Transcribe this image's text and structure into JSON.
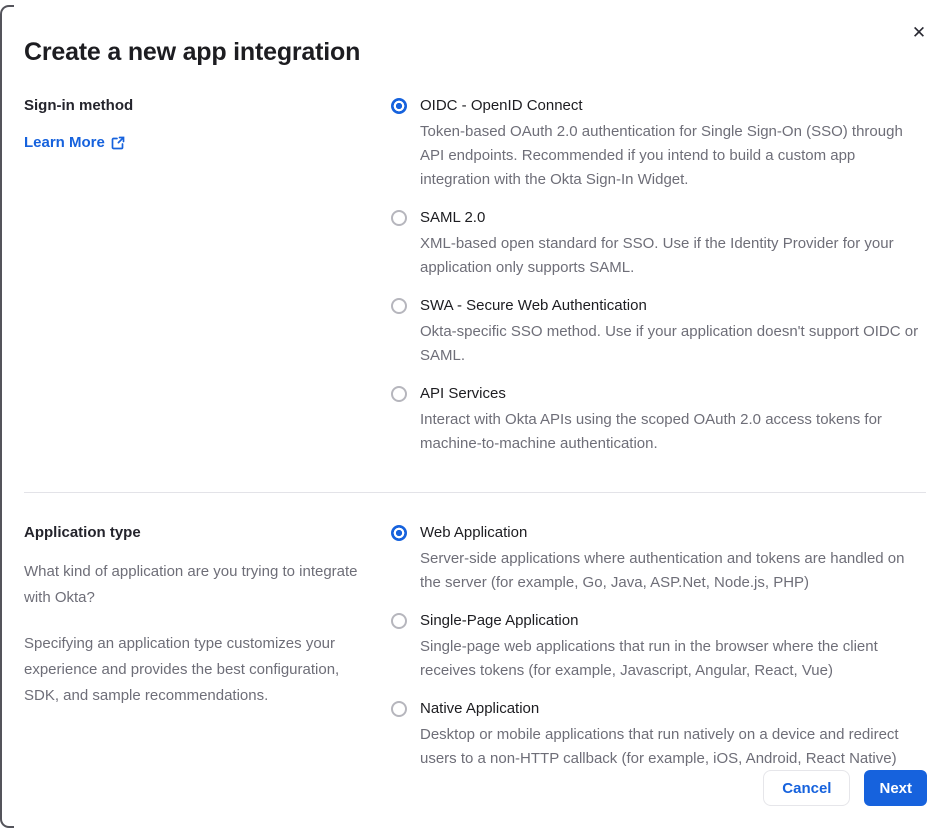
{
  "dialog": {
    "title": "Create a new app integration"
  },
  "icons": {
    "close": "✕",
    "external_link": "external-link"
  },
  "colors": {
    "accent_blue": "#1662dd",
    "text_dark": "#1d1d21",
    "text_gray": "#6e6e78",
    "divider": "#e3e3e8"
  },
  "signin_section": {
    "label": "Sign-in method",
    "learn_more_label": "Learn More",
    "options": [
      {
        "label": "OIDC - OpenID Connect",
        "description": "Token-based OAuth 2.0 authentication for Single Sign-On (SSO) through API endpoints. Recommended if you intend to build a custom app integration with the Okta Sign-In Widget.",
        "selected": true
      },
      {
        "label": "SAML 2.0",
        "description": "XML-based open standard for SSO. Use if the Identity Provider for your application only supports SAML.",
        "selected": false
      },
      {
        "label": "SWA - Secure Web Authentication",
        "description": "Okta-specific SSO method. Use if your application doesn't support OIDC or SAML.",
        "selected": false
      },
      {
        "label": "API Services",
        "description": "Interact with Okta APIs using the scoped OAuth 2.0 access tokens for machine-to-machine authentication.",
        "selected": false
      }
    ]
  },
  "apptype_section": {
    "label": "Application type",
    "paragraph1": "What kind of application are you trying to integrate with Okta?",
    "paragraph2": "Specifying an application type customizes your experience and provides the best configuration, SDK, and sample recommendations.",
    "options": [
      {
        "label": "Web Application",
        "description": "Server-side applications where authentication and tokens are handled on the server (for example, Go, Java, ASP.Net, Node.js, PHP)",
        "selected": true
      },
      {
        "label": "Single-Page Application",
        "description": "Single-page web applications that run in the browser where the client receives tokens (for example, Javascript, Angular, React, Vue)",
        "selected": false
      },
      {
        "label": "Native Application",
        "description": "Desktop or mobile applications that run natively on a device and redirect users to a non-HTTP callback (for example, iOS, Android, React Native)",
        "selected": false
      }
    ]
  },
  "footer": {
    "cancel_label": "Cancel",
    "next_label": "Next"
  }
}
